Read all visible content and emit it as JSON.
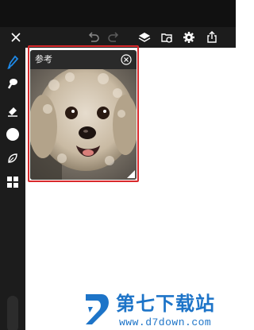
{
  "toolbar": {
    "icons": [
      "close-icon",
      "undo-icon",
      "redo-icon",
      "layers-icon",
      "import-image-icon",
      "settings-gear-icon",
      "share-icon"
    ],
    "active_color": "#ffffff",
    "disabled_color": "#6a6a6a"
  },
  "sidebar": {
    "tools": [
      "pen-tool-icon",
      "brush-icon",
      "eraser-icon",
      "color-swatch-icon",
      "smudge-leaf-icon",
      "gallery-grid-icon"
    ],
    "active_tool_color": "#1e88e5",
    "selected_color": "#ffffff"
  },
  "reference_panel": {
    "title": "参考",
    "highlight_color": "#d9292c"
  },
  "watermark": {
    "title": "第七下载站",
    "url": "www.d7down.com",
    "color": "#1d74c8"
  }
}
